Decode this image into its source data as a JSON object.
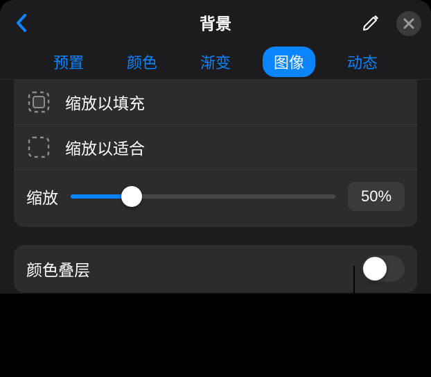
{
  "header": {
    "title": "背景"
  },
  "tabs": [
    {
      "label": "预置",
      "active": false
    },
    {
      "label": "颜色",
      "active": false
    },
    {
      "label": "渐变",
      "active": false
    },
    {
      "label": "图像",
      "active": true
    },
    {
      "label": "动态",
      "active": false
    }
  ],
  "options": {
    "scale_to_fill": "缩放以填充",
    "scale_to_fit": "缩放以适合"
  },
  "slider": {
    "label": "缩放",
    "value_text": "50%",
    "percent": 23
  },
  "overlay": {
    "label": "颜色叠层",
    "on": false
  },
  "colors": {
    "accent": "#0a84ff"
  }
}
